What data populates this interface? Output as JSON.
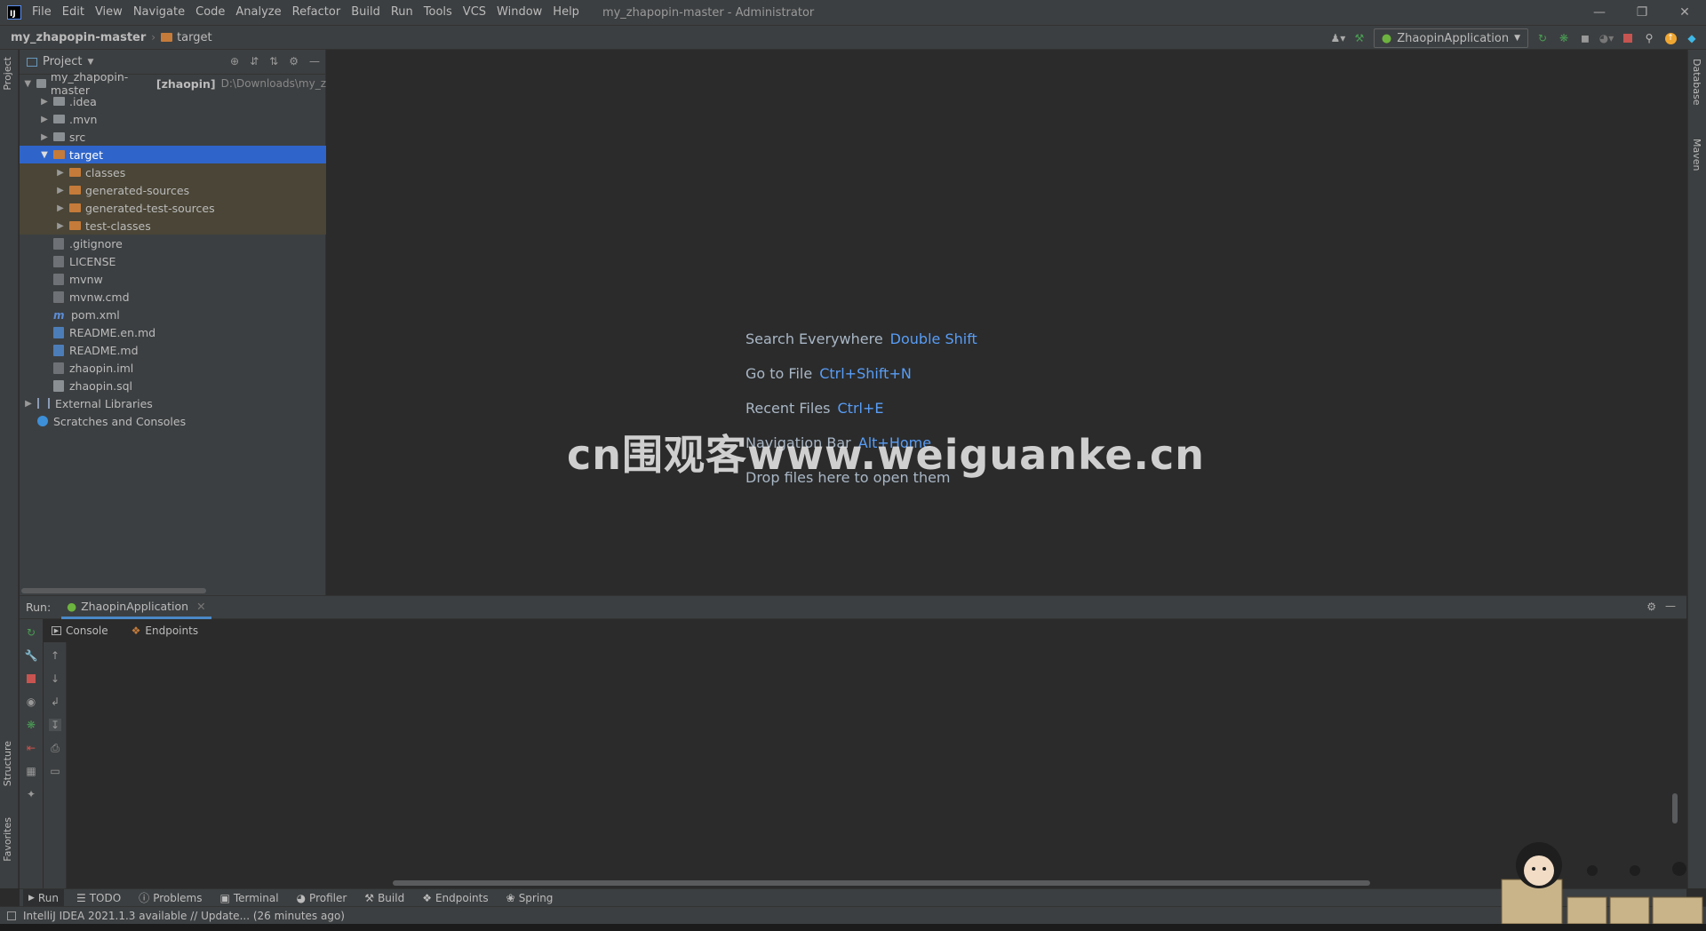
{
  "titlebar": {
    "app_icon": "IJ",
    "menu": [
      "File",
      "Edit",
      "View",
      "Navigate",
      "Code",
      "Analyze",
      "Refactor",
      "Build",
      "Run",
      "Tools",
      "VCS",
      "Window",
      "Help"
    ],
    "window_title": "my_zhapopin-master - Administrator"
  },
  "navbar": {
    "project": "my_zhapopin-master",
    "current_folder": "target",
    "run_config": "ZhaopinApplication"
  },
  "project_panel": {
    "title": "Project",
    "tree": [
      {
        "label": "my_zhapopin-master",
        "module": "[zhaopin]",
        "path": "D:\\Downloads\\my_z"
      },
      {
        "label": ".idea"
      },
      {
        "label": ".mvn"
      },
      {
        "label": "src"
      },
      {
        "label": "target"
      },
      {
        "label": "classes"
      },
      {
        "label": "generated-sources"
      },
      {
        "label": "generated-test-sources"
      },
      {
        "label": "test-classes"
      },
      {
        "label": ".gitignore"
      },
      {
        "label": "LICENSE"
      },
      {
        "label": "mvnw"
      },
      {
        "label": "mvnw.cmd"
      },
      {
        "label": "pom.xml"
      },
      {
        "label": "README.en.md"
      },
      {
        "label": "README.md"
      },
      {
        "label": "zhaopin.iml"
      },
      {
        "label": "zhaopin.sql"
      },
      {
        "label": "External Libraries"
      },
      {
        "label": "Scratches and Consoles"
      }
    ]
  },
  "editor": {
    "hints": [
      {
        "text": "Search Everywhere",
        "key": "Double Shift"
      },
      {
        "text": "Go to File",
        "key": "Ctrl+Shift+N"
      },
      {
        "text": "Recent Files",
        "key": "Ctrl+E"
      },
      {
        "text": "Navigation Bar",
        "key": "Alt+Home"
      },
      {
        "text": "Drop files here to open them",
        "key": ""
      }
    ],
    "watermark": "cn围观客www.weiguanke.cn"
  },
  "run_panel": {
    "label": "Run:",
    "tab": "ZhaopinApplication",
    "subtabs": [
      "Console",
      "Endpoints"
    ]
  },
  "side_tabs": {
    "left_top": "Project",
    "left_structure": "Structure",
    "left_favorites": "Favorites",
    "right_database": "Database",
    "right_maven": "Maven"
  },
  "tool_windows": [
    "Run",
    "TODO",
    "Problems",
    "Terminal",
    "Profiler",
    "Build",
    "Endpoints",
    "Spring"
  ],
  "status": {
    "message": "IntelliJ IDEA 2021.1.3 available // Update... (26 minutes ago)"
  },
  "colors": {
    "accent": "#2f65ca",
    "link": "#589df6",
    "folder": "#c57b3a",
    "excluded_bg": "#4a4536",
    "stop_red": "#c75450",
    "run_green": "#499c54"
  }
}
